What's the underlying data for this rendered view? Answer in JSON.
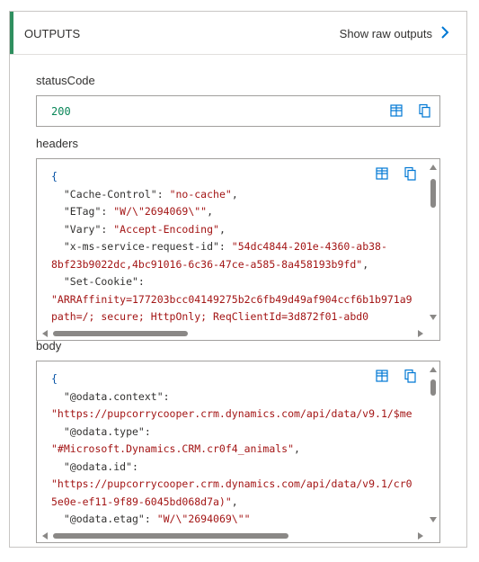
{
  "header": {
    "title": "OUTPUTS",
    "link_label": "Show raw outputs"
  },
  "sections": {
    "status": {
      "label": "statusCode",
      "value": "200"
    },
    "headers": {
      "label": "headers",
      "lines": [
        [
          [
            "{",
            "punct"
          ]
        ],
        [
          [
            "  \"Cache-Control\": ",
            "key"
          ],
          [
            "\"no-cache\"",
            "str"
          ],
          [
            ",",
            "key"
          ]
        ],
        [
          [
            "  \"ETag\": ",
            "key"
          ],
          [
            "\"W/\\\"2694069\\\"\"",
            "str"
          ],
          [
            ",",
            "key"
          ]
        ],
        [
          [
            "  \"Vary\": ",
            "key"
          ],
          [
            "\"Accept-Encoding\"",
            "str"
          ],
          [
            ",",
            "key"
          ]
        ],
        [
          [
            "  \"x-ms-service-request-id\": ",
            "key"
          ],
          [
            "\"54dc4844-201e-4360-ab38-",
            "str"
          ]
        ],
        [
          [
            "8bf23b9022dc,4bc91016-6c36-47ce-a585-8a458193b9fd\"",
            "str"
          ],
          [
            ",",
            "key"
          ]
        ],
        [
          [
            "  \"Set-Cookie\":",
            "key"
          ]
        ],
        [
          [
            "\"ARRAffinity=177203bcc04149275b2c6fb49d49af904ccf6b1b971a9",
            "str"
          ]
        ],
        [
          [
            "path=/; secure; HttpOnly; ReqClientId=3d872f01-abd0",
            "str"
          ]
        ]
      ]
    },
    "body": {
      "label": "body",
      "lines": [
        [
          [
            "{",
            "punct"
          ]
        ],
        [
          [
            "  \"@odata.context\":",
            "key"
          ]
        ],
        [
          [
            "\"https://pupcorrycooper.crm.dynamics.com/api/data/v9.1/$me",
            "str"
          ]
        ],
        [
          [
            "  \"@odata.type\":",
            "key"
          ]
        ],
        [
          [
            "\"#Microsoft.Dynamics.CRM.cr0f4_animals\"",
            "str"
          ],
          [
            ",",
            "key"
          ]
        ],
        [
          [
            "  \"@odata.id\":",
            "key"
          ]
        ],
        [
          [
            "\"https://pupcorrycooper.crm.dynamics.com/api/data/v9.1/cr0",
            "str"
          ]
        ],
        [
          [
            "5e0e-ef11-9f89-6045bd068d7a)\"",
            "str"
          ],
          [
            ",",
            "key"
          ]
        ],
        [
          [
            "  \"@odata.etag\": ",
            "key"
          ],
          [
            "\"W/\\\"2694069\\\"\"",
            "str"
          ]
        ]
      ]
    }
  },
  "icons": {
    "table": "table-view-icon",
    "copy": "copy-icon",
    "chevron": "chevron-right-icon"
  },
  "colors": {
    "accent": "#2f8f5f",
    "link_icon": "#0078d4",
    "string": "#a31515",
    "number": "#098658"
  }
}
